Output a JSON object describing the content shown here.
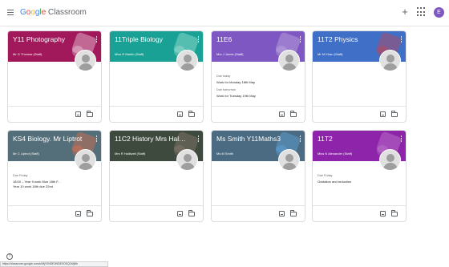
{
  "app": {
    "logo_parts": [
      "G",
      "o",
      "o",
      "g",
      "l",
      "e"
    ],
    "logo_suffix": " Classroom",
    "user_initial": "E",
    "help_glyph": "?",
    "status_url": "https://classroom.google.com/c/MjY0NDE0NDE0ODQ1MjNh"
  },
  "classes": [
    {
      "title": "Y11 Photography",
      "teacher": "Mr G Thomas (Staff)",
      "color": "#a1185b",
      "deco": "#ffffff",
      "due_label": "",
      "due_lines": []
    },
    {
      "title": "11Triple Biology",
      "teacher": "Miss R Martin (Staff)",
      "color": "#1aa195",
      "deco": "#c8f0e4",
      "due_label": "",
      "due_lines": []
    },
    {
      "title": "11E6",
      "teacher": "Mrs J Jones (Staff)",
      "color": "#7e57c2",
      "deco": "#d1c4e9",
      "due_label": "Due today",
      "due_lines": [
        "Work for Monday 18th May"
      ],
      "due_label2": "Due tomorrow",
      "due_lines2": [
        "Work for Tuesday 19th May"
      ]
    },
    {
      "title": "11T2 Physics",
      "teacher": "Mr M Khan (Staff)",
      "color": "#3f6fc7",
      "deco": "#e53935",
      "due_label": "",
      "due_lines": []
    },
    {
      "title": "KS4 Biology. Mr Liptrot",
      "teacher": "Mr C Liptrot (Staff)",
      "color": "#546e7a",
      "deco": "#ff7043",
      "due_label": "Due Friday",
      "due_lines": [
        "18:00 – Year 9 work Mon 18th F...",
        "Year 10 work 18th due 22nd"
      ]
    },
    {
      "title": "11C2 History Mrs Halliwell",
      "teacher": "Mrs R Halliwell (Staff)",
      "color": "#3e4a3d",
      "deco": "#a1887f",
      "due_label": "",
      "due_lines": []
    },
    {
      "title": "Ms Smith Y11Maths3",
      "teacher": "Ms M Smith",
      "color": "#4a6b82",
      "deco": "#64b5f6",
      "due_label": "",
      "due_lines": []
    },
    {
      "title": "11T2",
      "teacher": "Miss N Alexander (Staff)",
      "color": "#8e24aa",
      "deco": "#ce93d8",
      "due_label": "Due Friday",
      "due_lines": [
        "Oxidation and reduction"
      ]
    }
  ]
}
